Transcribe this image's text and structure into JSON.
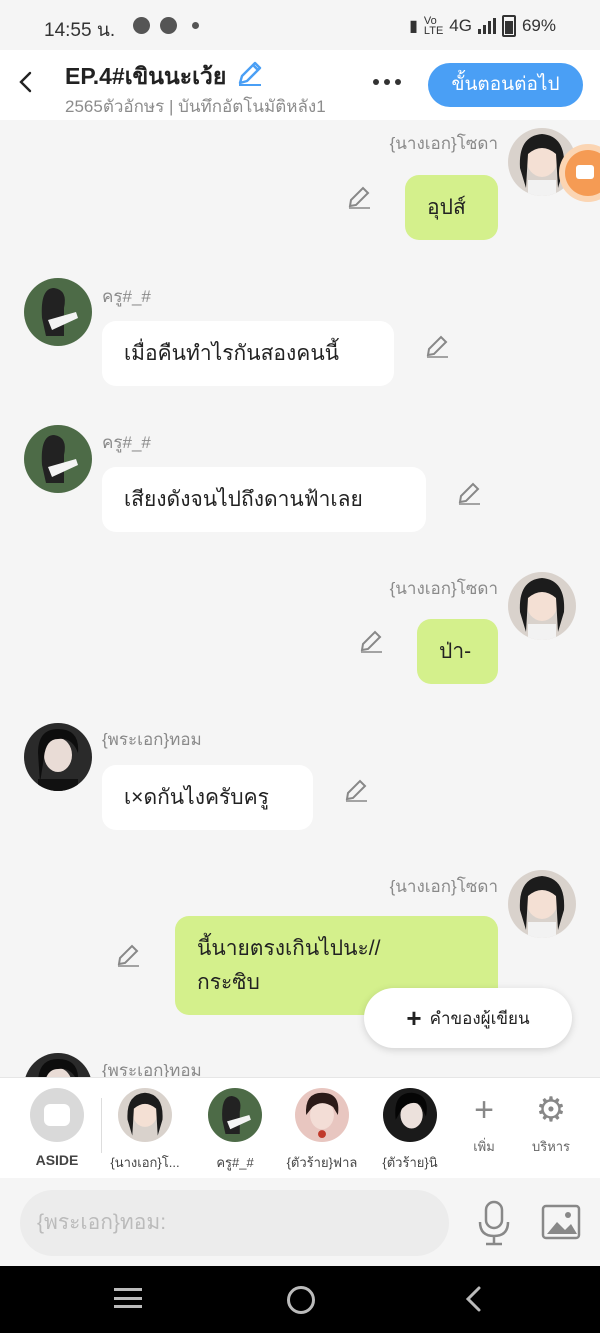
{
  "status_bar": {
    "time": "14:55 น.",
    "network": "4G",
    "battery": "69%"
  },
  "header": {
    "title": "EP.4#เขินนะเว้ย",
    "subtitle": "2565ตัวอักษร | บันทึกอัตโนมัติหลัง1",
    "next_button": "ขั้นตอนต่อไป"
  },
  "messages": [
    {
      "sender": "{นางเอก}โซดา",
      "text": "อุปส์",
      "side": "right"
    },
    {
      "sender": "ครู#_#",
      "text": "เมื่อคืนทำไรกันสองคนนี้",
      "side": "left"
    },
    {
      "sender": "ครู#_#",
      "text": "เสียงดังจนไปถึงดานฟ้าเลย",
      "side": "left"
    },
    {
      "sender": "{นางเอก}โซดา",
      "text": "ป่า-",
      "side": "right"
    },
    {
      "sender": "{พระเอก}ทอม",
      "text": "เ×ดกันไงครับครู",
      "side": "left"
    },
    {
      "sender": "{นางเอก}โซดา",
      "text_lines": [
        "นี้นายตรงเกินไปนะ//",
        "กระซิบ"
      ],
      "side": "right"
    },
    {
      "sender": "{พระเอก}ทอม",
      "text": "",
      "side": "left"
    }
  ],
  "writer_note_button": "คำของผู้เขียน",
  "characters": [
    {
      "label": "ASIDE"
    },
    {
      "label": "{นางเอก}โ..."
    },
    {
      "label": "ครู#_#"
    },
    {
      "label": "{ตัวร้าย}ฟาล"
    },
    {
      "label": "{ตัวร้าย}นิ"
    }
  ],
  "tools": {
    "add_label": "เพิ่ม",
    "manage_label": "บริหาร"
  },
  "input": {
    "placeholder": "{พระเอก}ทอม:"
  },
  "colors": {
    "accent": "#4a9ff5",
    "bubble_green": "#d4f08c",
    "bubble_white": "#ffffff"
  }
}
